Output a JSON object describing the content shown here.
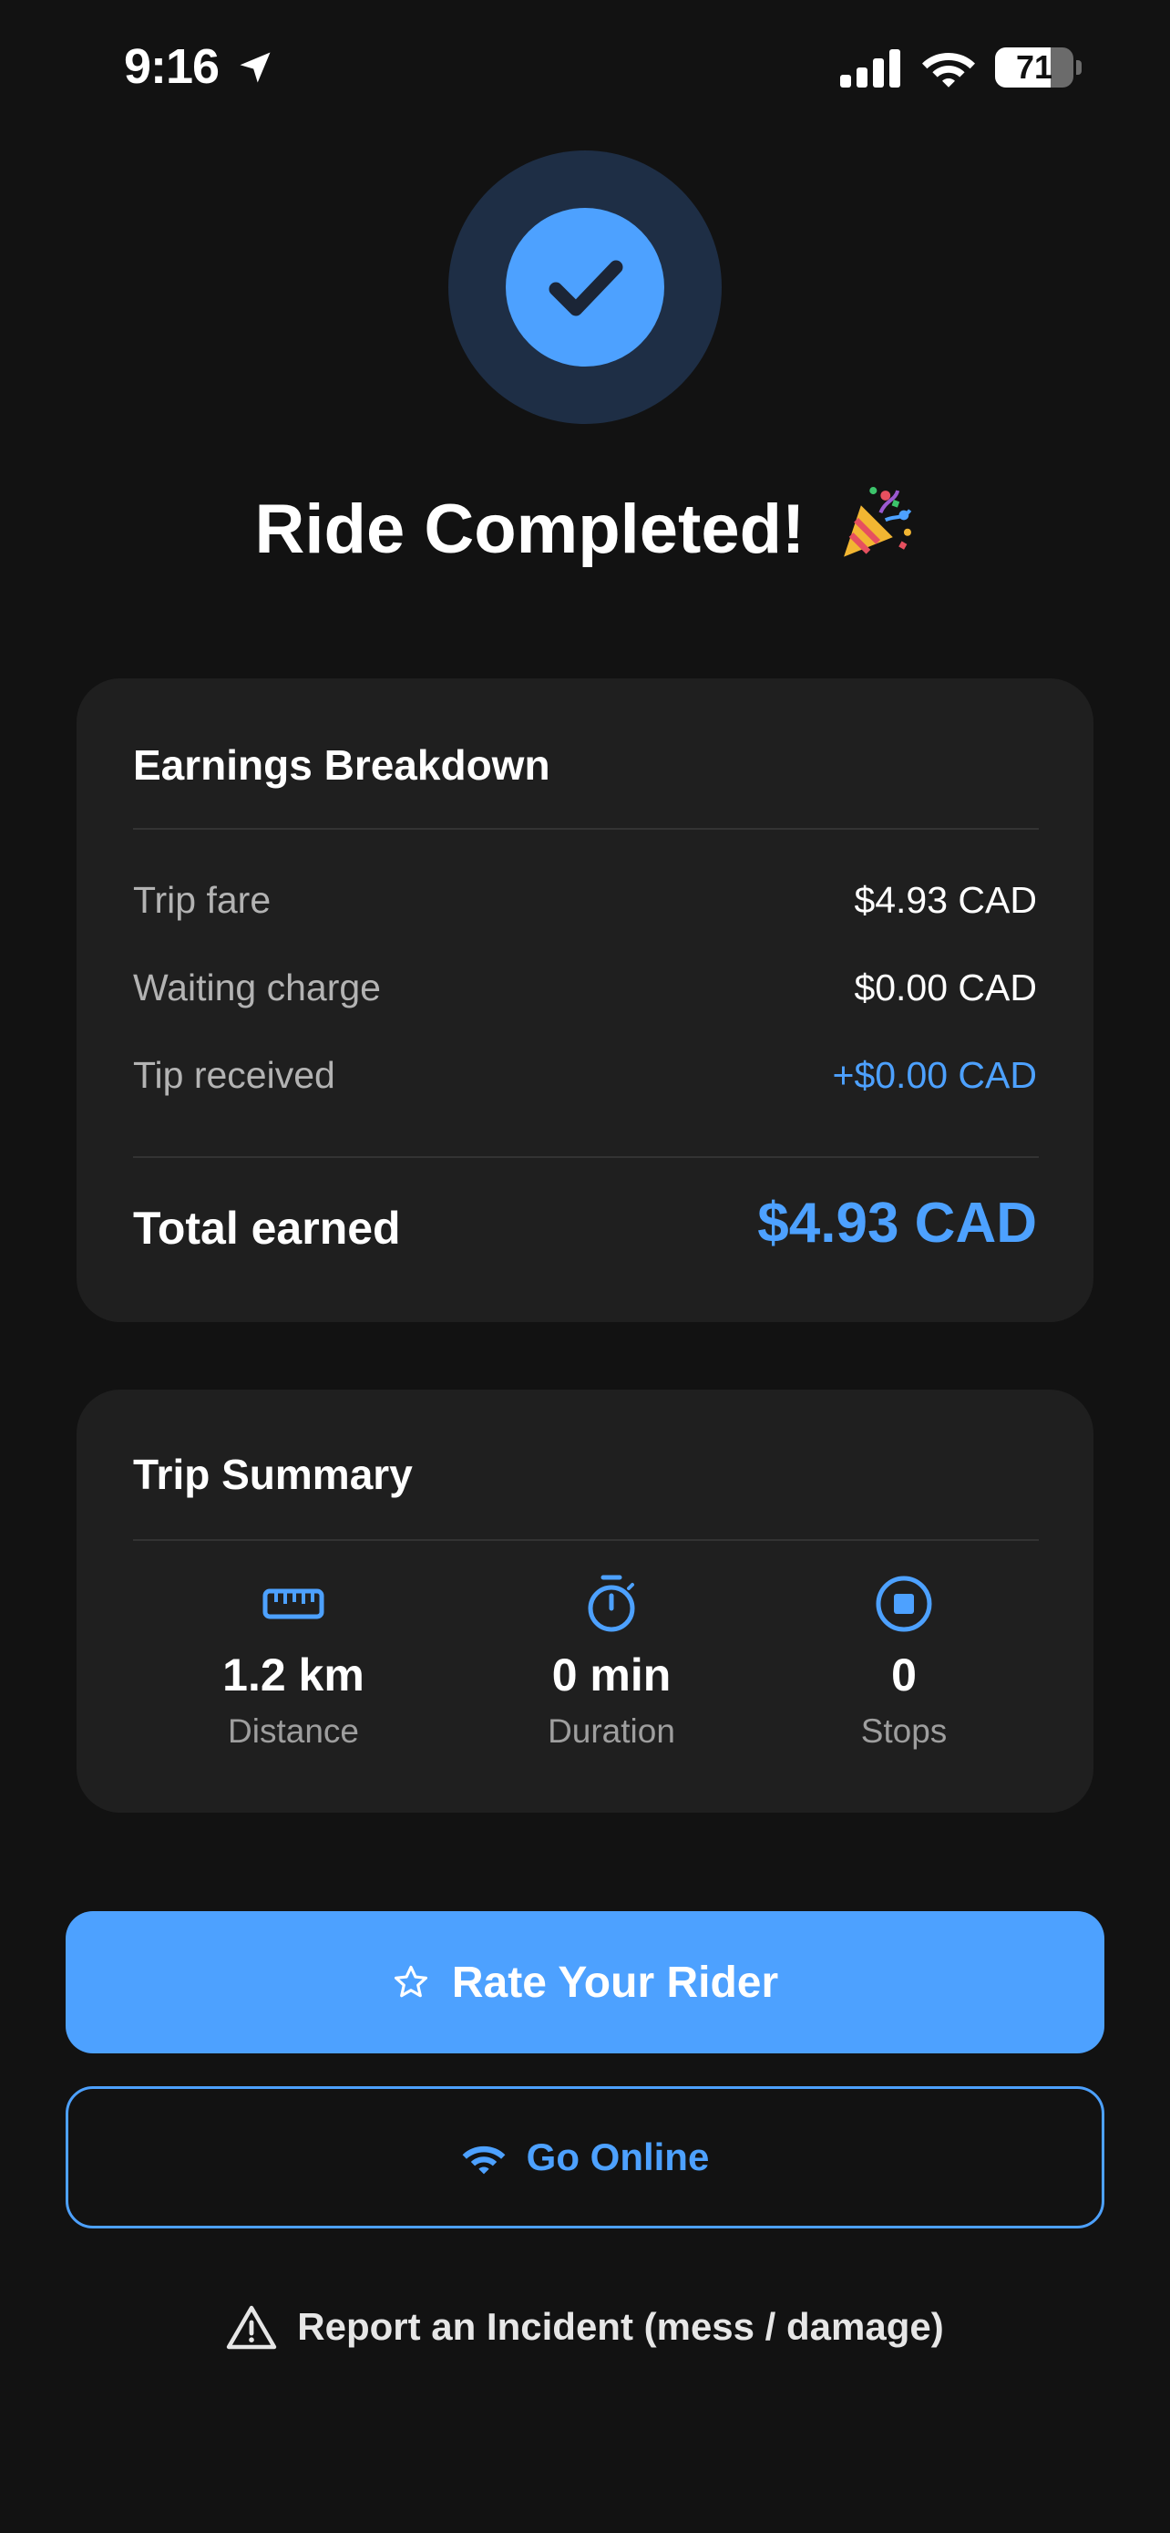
{
  "status_bar": {
    "time": "9:16",
    "battery_level": "71",
    "battery_fraction": 0.71,
    "icons": [
      "location-arrow-icon",
      "cellular-signal-icon",
      "wifi-icon",
      "battery-icon"
    ]
  },
  "header": {
    "badge_icon": "checkmark-icon",
    "title": "Ride Completed!",
    "emoji_icon": "party-popper-icon"
  },
  "earnings": {
    "title": "Earnings Breakdown",
    "rows": [
      {
        "label": "Trip fare",
        "value": "$4.93 CAD"
      },
      {
        "label": "Waiting charge",
        "value": "$0.00 CAD"
      },
      {
        "label": "Tip received",
        "value": "+$0.00 CAD"
      }
    ],
    "total_label": "Total earned",
    "total_value": "$4.93 CAD"
  },
  "trip_summary": {
    "title": "Trip Summary",
    "stats": [
      {
        "icon": "ruler-icon",
        "value": "1.2 km",
        "label": "Distance"
      },
      {
        "icon": "stopwatch-icon",
        "value": "0 min",
        "label": "Duration"
      },
      {
        "icon": "stop-circle-icon",
        "value": "0",
        "label": "Stops"
      }
    ]
  },
  "actions": {
    "rate_label": "Rate Your Rider",
    "rate_icon": "star-outline-icon",
    "online_label": "Go Online",
    "online_icon": "wifi-icon",
    "report_label": "Report an Incident (mess / damage)",
    "report_icon": "warning-triangle-icon"
  },
  "colors": {
    "background": "#121212",
    "card": "#1f1f1f",
    "accent": "#4da1ff",
    "badge_ring": "#1e2e45",
    "muted_text": "#b3b3b3"
  }
}
